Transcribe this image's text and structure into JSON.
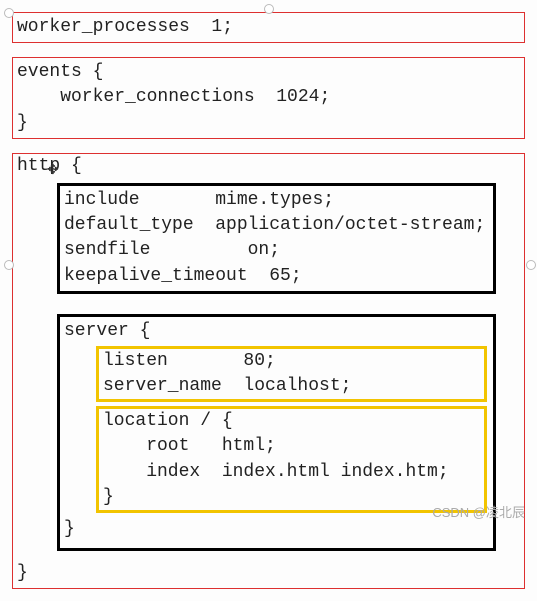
{
  "config": {
    "worker_processes": "worker_processes  1;",
    "events_open": "events {",
    "events_body": "    worker_connections  1024;",
    "events_close": "}",
    "http_open": "http {",
    "http_block": "include       mime.types;\ndefault_type  application/octet-stream;\nsendfile         on;\nkeepalive_timeout  65;",
    "server_open": "server {",
    "server_listen": "listen       80;\nserver_name  localhost;",
    "server_location": "location / {\n    root   html;\n    index  index.html index.htm;\n}",
    "server_close": "}",
    "http_close": "}"
  },
  "watermark": "CSDN @凌北辰"
}
